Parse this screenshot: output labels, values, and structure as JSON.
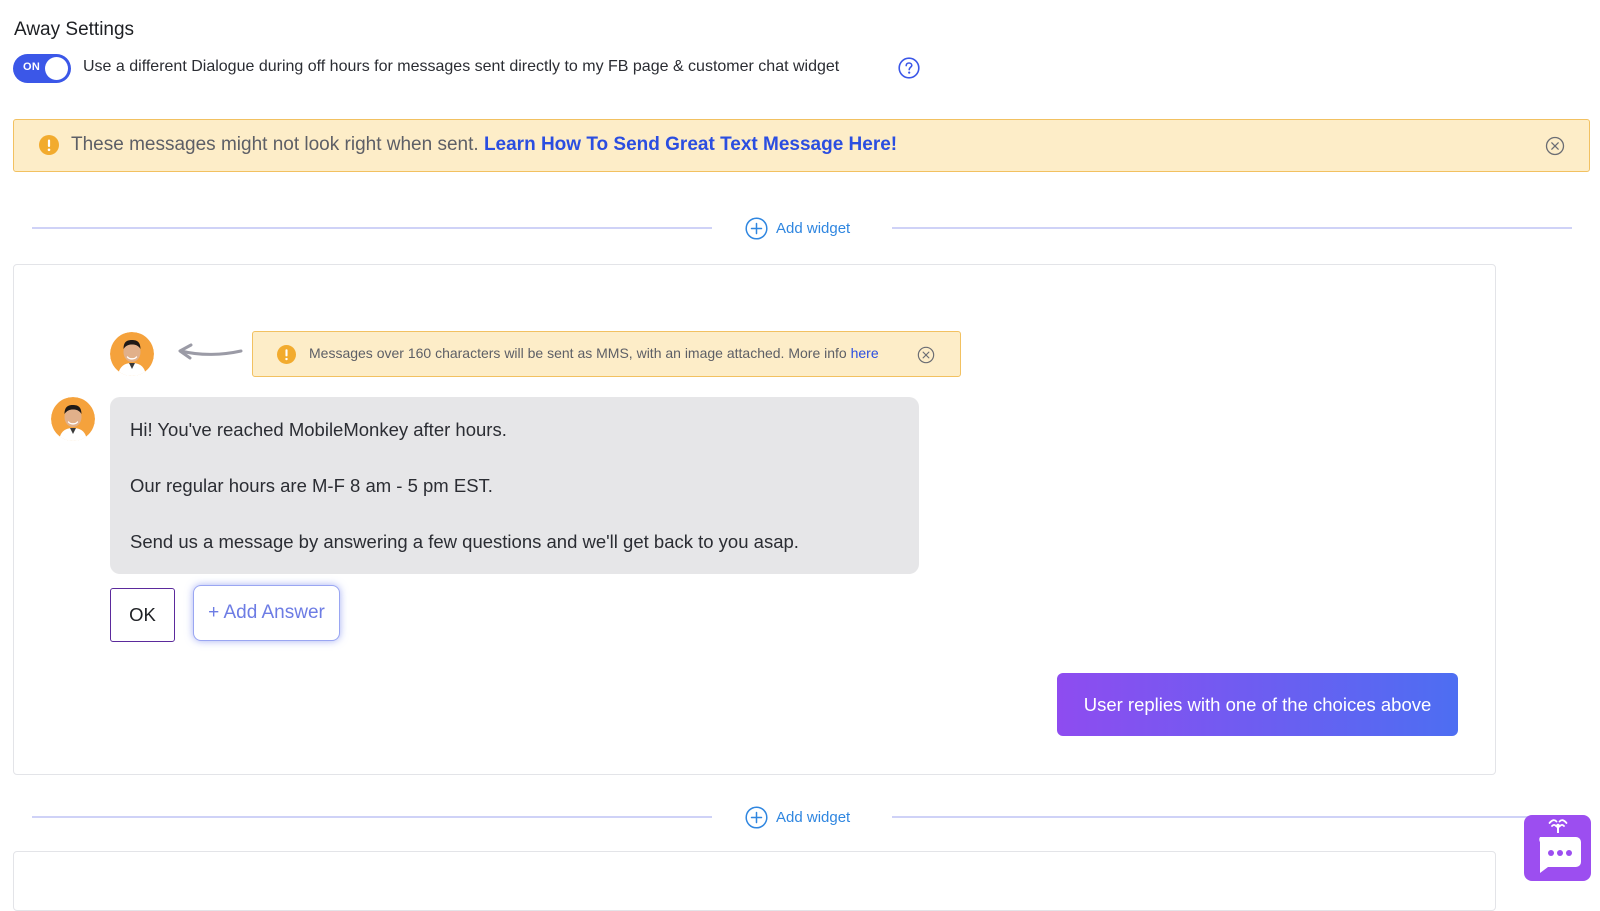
{
  "header": {
    "title": "Away Settings",
    "toggle_label": "ON",
    "toggle_state": "on",
    "description": "Use a different Dialogue during off hours for messages sent directly to my FB page & customer chat widget",
    "help_icon": "question-circle-icon"
  },
  "banner": {
    "text": "These messages might not look right when sent.",
    "link": "Learn How To Send Great Text Message Here!",
    "icon": "warning-icon",
    "close_icon": "close-circle-icon"
  },
  "add_widget": {
    "label": "Add widget",
    "icon": "plus-circle-icon"
  },
  "message_card": {
    "mms_warning": {
      "text": "Messages over 160 characters will be sent as MMS, with an image attached. More info",
      "link": "here"
    },
    "bubble_lines": [
      "Hi! You've reached MobileMonkey after hours.",
      "Our regular hours are M-F 8 am - 5 pm EST.",
      "Send us a message by answering a few questions and we'll get back to you asap."
    ],
    "answers": [
      "OK"
    ],
    "add_answer_label": "+ Add Answer",
    "user_reply_label": "User replies with one of the choices above"
  },
  "colors": {
    "accent": "#3b57e8",
    "warning_bg": "#fdedc8",
    "warning_border": "#f2c161",
    "link": "#2b4ee0",
    "widget_link": "#2f86e0",
    "reply_gradient_start": "#8e4cf0",
    "reply_gradient_end": "#4d6ef2",
    "launcher": "#9c4ef0"
  },
  "launcher_icon": "chat-bot-icon"
}
